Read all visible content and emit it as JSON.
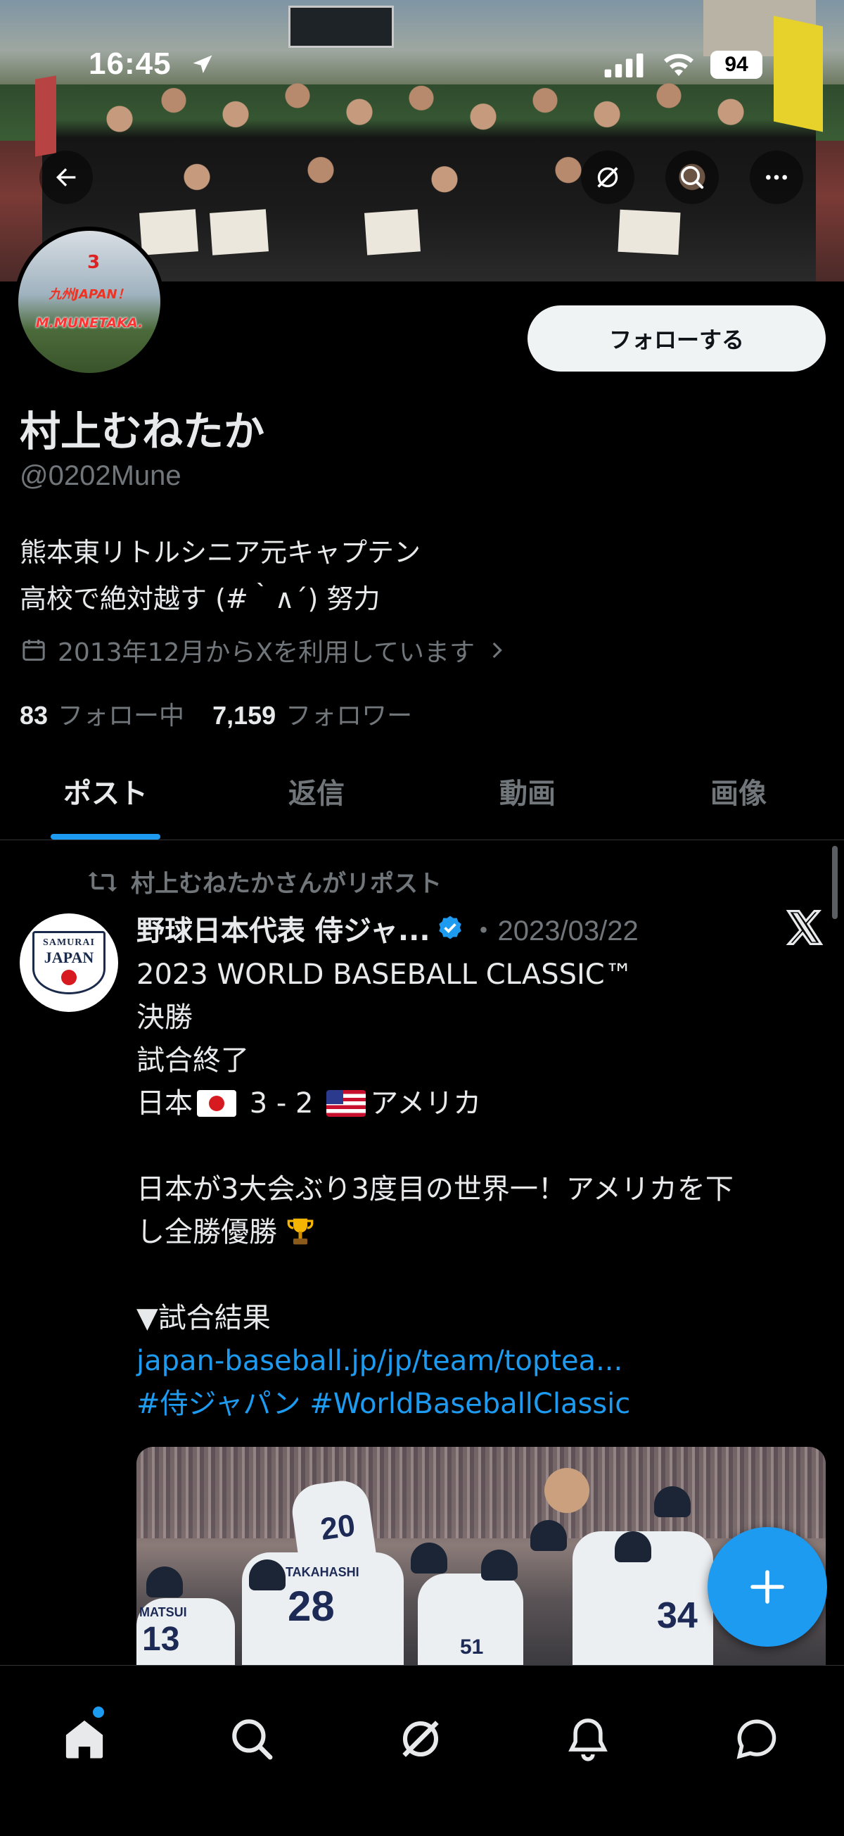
{
  "status_bar": {
    "time": "16:45",
    "battery": "94"
  },
  "profile": {
    "display_name": "村上むねたか",
    "handle": "@0202Mune",
    "bio_lines": [
      "熊本東リトルシニア元キャプテン",
      "高校で絶対越す (#｀∧´) 努力"
    ],
    "joined": "2013年12月からXを利用しています",
    "following_count": "83",
    "following_label": "フォロー中",
    "followers_count": "7,159",
    "followers_label": "フォロワー",
    "follow_button": "フォローする",
    "avatar_text_1": "九州JAPAN！",
    "avatar_text_2": "M.MUNETAKA.",
    "avatar_number": "3"
  },
  "tabs": [
    {
      "label": "ポスト",
      "active": true
    },
    {
      "label": "返信",
      "active": false
    },
    {
      "label": "動画",
      "active": false
    },
    {
      "label": "画像",
      "active": false
    }
  ],
  "post": {
    "repost_label": "村上むねたかさんがリポスト",
    "author_name": "野球日本代表 侍ジャ...",
    "author_avatar_text_1": "SAMURAI",
    "author_avatar_text_2": "JAPAN",
    "date": "・2023/03/22",
    "lines": {
      "l1": "2023 WORLD BASEBALL CLASSIC™",
      "l2": "決勝",
      "l3": "試合終了",
      "l4_a": "日本",
      "l4_score": "3 - 2",
      "l4_b": "アメリカ",
      "l5": "日本が3大会ぶり3度目の世界一！アメリカを下",
      "l6": "し全勝優勝",
      "l7": "▼試合結果",
      "link": "japan-baseball.jp/jp/team/toptea...",
      "hashtags": "#侍ジャパン #WorldBaseballClassic"
    },
    "media_jersey_numbers": [
      "20",
      "28",
      "13",
      "51",
      "34"
    ],
    "media_jersey_names": [
      "TAKAHASHI",
      "MATSUI"
    ]
  },
  "colors": {
    "accent": "#1d9bf0",
    "background": "#000000",
    "muted_text": "#71767b",
    "primary_text": "#e7e9ea"
  },
  "icons": {
    "header": [
      "back-arrow-icon",
      "grok-icon",
      "search-icon",
      "more-icon"
    ],
    "bottom_nav": [
      "home-icon",
      "search-icon",
      "grok-icon",
      "notifications-icon",
      "messages-icon"
    ]
  }
}
